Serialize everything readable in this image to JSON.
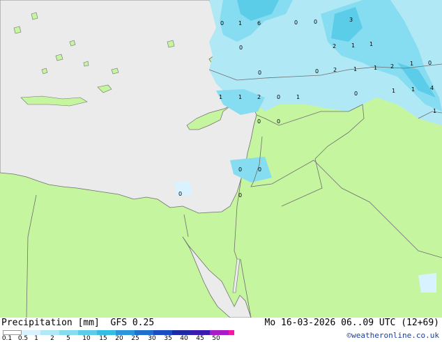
{
  "legend": {
    "title": "Precipitation [mm]",
    "model": "GFS 0.25",
    "ticks": [
      "0.1",
      "0.5",
      "1",
      "2",
      "5",
      "10",
      "15",
      "20",
      "25",
      "30",
      "35",
      "40",
      "45",
      "50"
    ],
    "colors": [
      "#d8f2ff",
      "#b0e8f6",
      "#86dcf0",
      "#5ccde8",
      "#36bde4",
      "#2a96dc",
      "#2070d0",
      "#1c4cc4",
      "#1c2aa8",
      "#3a1ab0",
      "#7418c0",
      "#a81ac8",
      "#d21ad0",
      "#f01aa0"
    ]
  },
  "validity": "Mo 16-03-2026 06..09 UTC (12+69)",
  "credit": "©weatheronline.co.uk",
  "map_labels": [
    "0",
    "1",
    "6",
    "0",
    "0",
    "3",
    "0",
    "2",
    "1",
    "1",
    "2",
    "1",
    "0",
    "0",
    "2",
    "1",
    "1",
    "0",
    "1",
    "4",
    "1",
    "1",
    "2",
    "0",
    "1",
    "0",
    "1",
    "0",
    "0",
    "0",
    "0",
    "0",
    "0",
    "1"
  ],
  "colors": {
    "land": "#c6f5a0",
    "sea": "#ebebeb",
    "border": "#6e6e6e"
  }
}
